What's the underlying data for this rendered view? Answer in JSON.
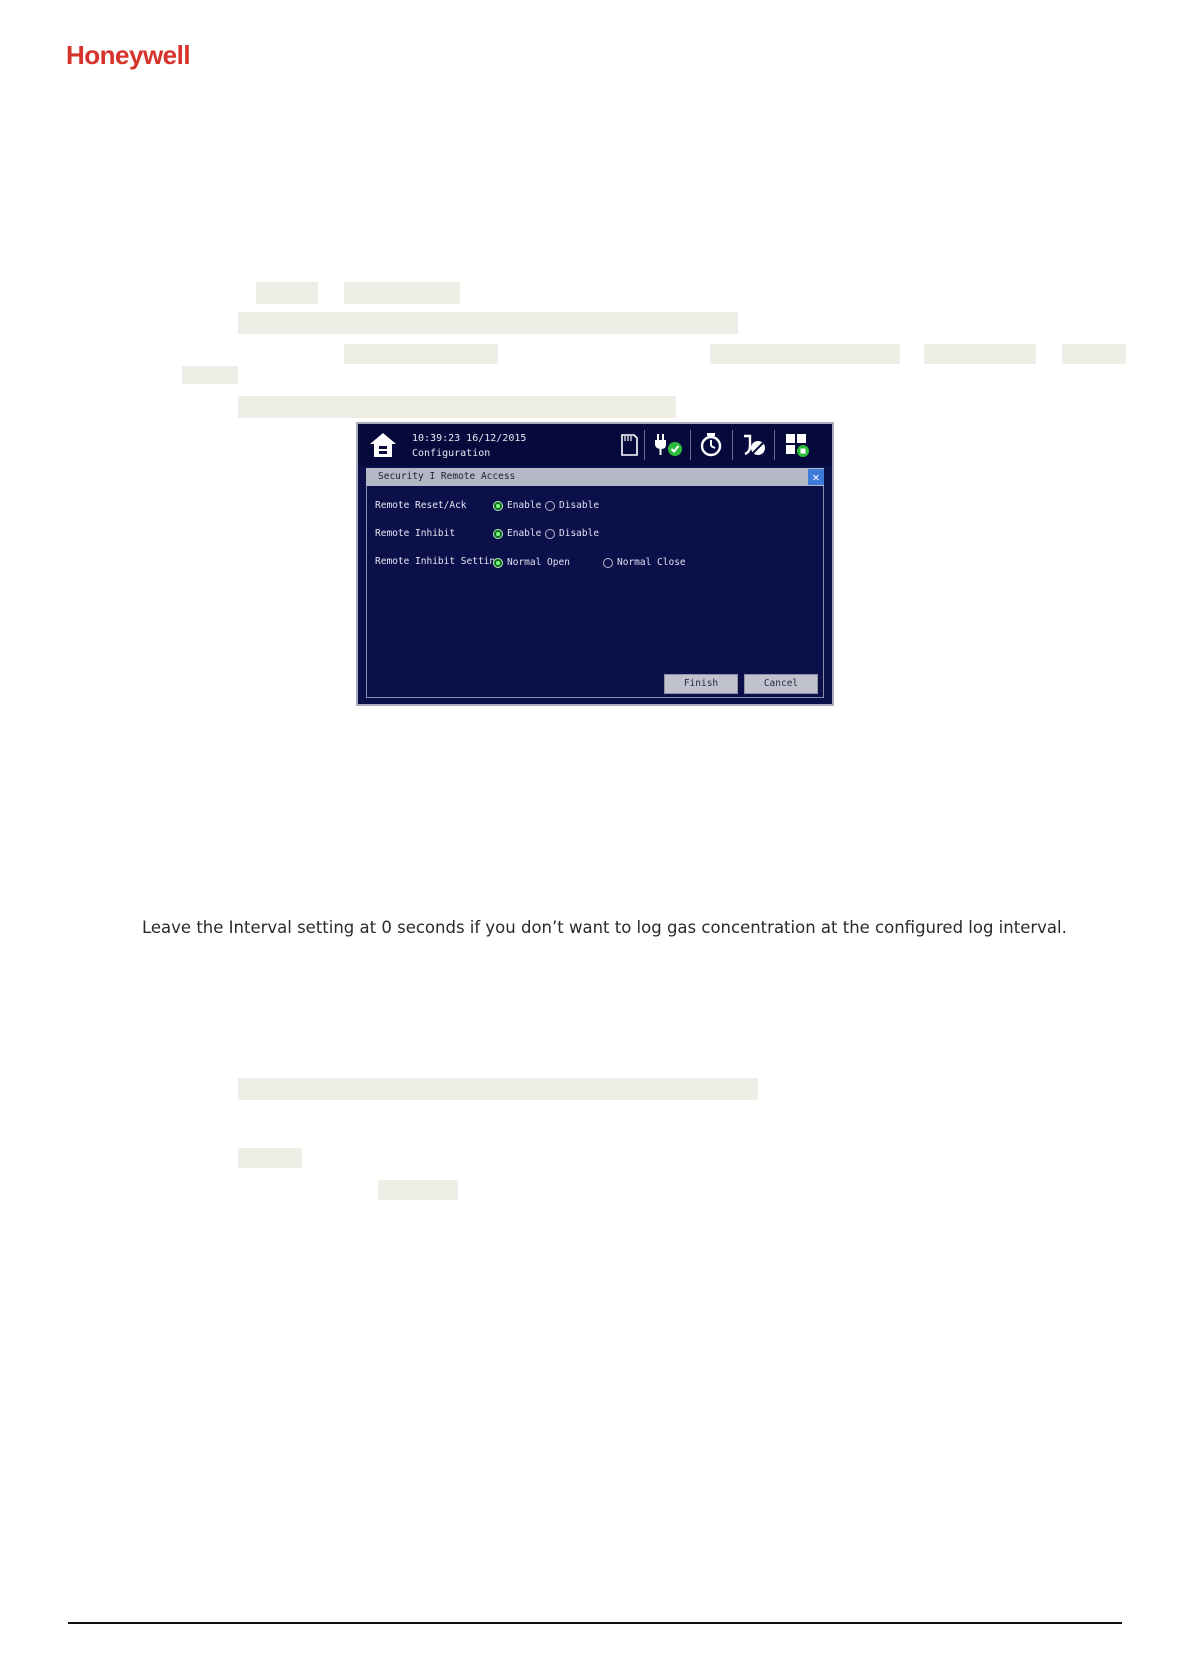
{
  "brand": {
    "logo_text": "Honeywell"
  },
  "device": {
    "time": "10:39:23 16/12/2015",
    "screen": "Configuration",
    "dialog_title": "Security I Remote Access",
    "close_glyph": "✕",
    "rows": [
      {
        "label": "Remote Reset/Ack",
        "options": [
          "Enable",
          "Disable"
        ],
        "selected": "Enable"
      },
      {
        "label": "Remote Inhibit",
        "options": [
          "Enable",
          "Disable"
        ],
        "selected": "Enable"
      },
      {
        "label": "Remote Inhibit Setting",
        "options": [
          "Normal Open",
          "Normal Close"
        ],
        "selected": "Normal Open"
      }
    ],
    "finish_label": "Finish",
    "cancel_label": "Cancel",
    "icons": [
      "home-icon",
      "sd-card-icon",
      "power-check-icon",
      "timer-icon",
      "calibration-icon",
      "grid-status-icon"
    ]
  },
  "body_text": "Leave the Interval setting at 0 seconds if you don’t want to log gas concentration at the configured log interval.",
  "colors": {
    "brand_red": "#d6332a",
    "device_bg": "#0b0f4a",
    "radio_selected": "#22c32a"
  }
}
